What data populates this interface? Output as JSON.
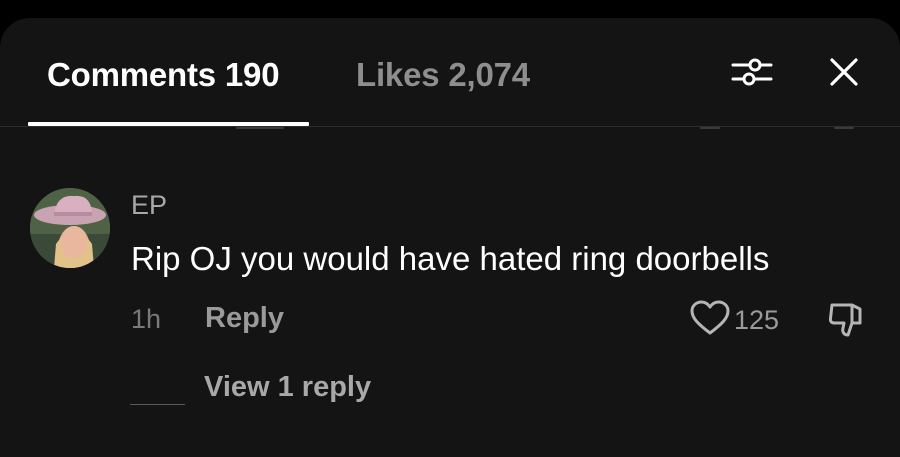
{
  "tabs": {
    "comments": {
      "label": "Comments",
      "count": "190"
    },
    "likes": {
      "label": "Likes",
      "count": "2,074"
    }
  },
  "toolbar": {
    "filter_icon": "sliders-icon",
    "close_icon": "close-icon"
  },
  "comment": {
    "username": "EP",
    "text": "Rip OJ you would have hated ring doorbells",
    "time": "1h",
    "reply_label": "Reply",
    "like_count": "125",
    "liked": false,
    "view_replies_label": "View 1 reply"
  },
  "colors": {
    "background": "#141414",
    "text_primary": "#ffffff",
    "text_secondary": "#a8a8a8",
    "divider": "#2e2e2e"
  }
}
